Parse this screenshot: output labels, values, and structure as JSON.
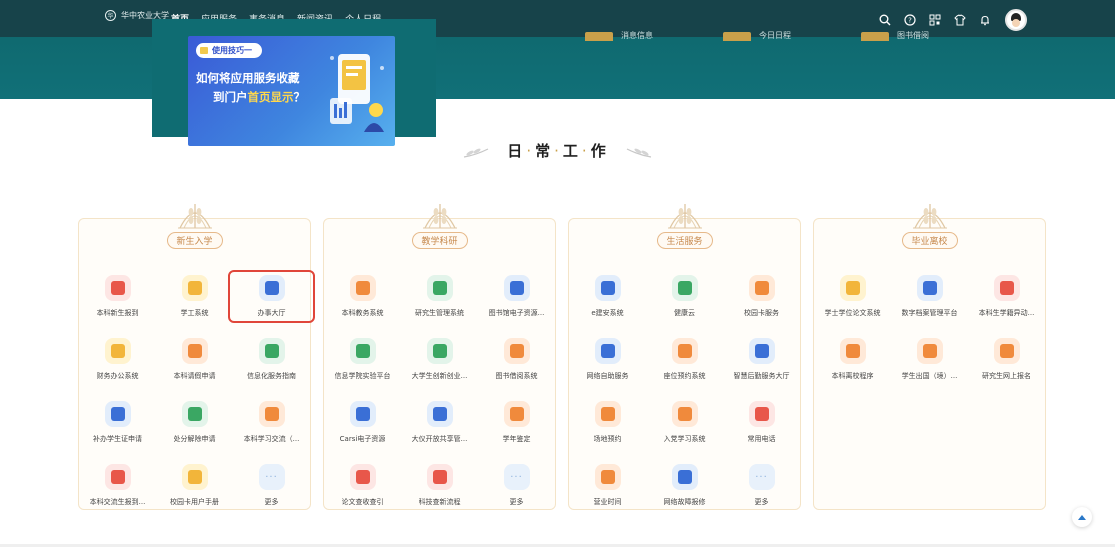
{
  "nav": {
    "brand": "华中农业大学",
    "items": [
      "首页",
      "应用服务",
      "事务消息",
      "新闻资讯",
      "个人日程"
    ],
    "icons": [
      "search-icon",
      "help-icon",
      "qrcode-icon",
      "shirt-icon",
      "bell-icon"
    ]
  },
  "quick_links": [
    "消息信息",
    "今日日程",
    "图书借阅"
  ],
  "banner": {
    "tip": "使用技巧一",
    "title_line1": "如何将应用服务收藏",
    "title_line2_pre": "到门户",
    "title_line2_hl": "首页显示",
    "title_line2_post": "？"
  },
  "section": {
    "title": [
      "日",
      "常",
      "工",
      "作"
    ]
  },
  "cards": [
    {
      "tag": "新生入学",
      "apps": [
        {
          "label": "本科新生报到",
          "color": "red"
        },
        {
          "label": "学工系统",
          "color": "yellow"
        },
        {
          "label": "办事大厅",
          "color": "blue",
          "highlight": true
        },
        {
          "label": "财务办公系统",
          "color": "yellow"
        },
        {
          "label": "本科请假申请",
          "color": "orange"
        },
        {
          "label": "信息化服务指南",
          "color": "green"
        },
        {
          "label": "补办学生证申请",
          "color": "blue"
        },
        {
          "label": "处分解除申请",
          "color": "green"
        },
        {
          "label": "本科学习交流（...",
          "color": "orange"
        },
        {
          "label": "本科交流生报到...",
          "color": "red"
        },
        {
          "label": "校园卡用户手册",
          "color": "yellow"
        },
        {
          "label": "更多",
          "color": "more"
        }
      ]
    },
    {
      "tag": "教学科研",
      "apps": [
        {
          "label": "本科教务系统",
          "color": "orange"
        },
        {
          "label": "研究生管理系统",
          "color": "green"
        },
        {
          "label": "图书馆电子资源...",
          "color": "blue"
        },
        {
          "label": "信息学院实验平台",
          "color": "green"
        },
        {
          "label": "大学生创新创业...",
          "color": "green"
        },
        {
          "label": "图书借阅系统",
          "color": "orange"
        },
        {
          "label": "Carsi电子资源",
          "color": "blue"
        },
        {
          "label": "大仪开放共享管...",
          "color": "blue"
        },
        {
          "label": "学年鉴定",
          "color": "orange"
        },
        {
          "label": "论文查收查引",
          "color": "red"
        },
        {
          "label": "科技查新流程",
          "color": "red"
        },
        {
          "label": "更多",
          "color": "more"
        }
      ]
    },
    {
      "tag": "生活服务",
      "apps": [
        {
          "label": "e建安系统",
          "color": "blue"
        },
        {
          "label": "健康云",
          "color": "green"
        },
        {
          "label": "校园卡服务",
          "color": "orange"
        },
        {
          "label": "网络自助服务",
          "color": "blue"
        },
        {
          "label": "座位预约系统",
          "color": "orange"
        },
        {
          "label": "智慧后勤服务大厅",
          "color": "blue"
        },
        {
          "label": "场地预约",
          "color": "orange"
        },
        {
          "label": "入党学习系统",
          "color": "orange"
        },
        {
          "label": "常用电话",
          "color": "red"
        },
        {
          "label": "营业时间",
          "color": "orange"
        },
        {
          "label": "网络故障报修",
          "color": "blue"
        },
        {
          "label": "更多",
          "color": "more"
        }
      ]
    },
    {
      "tag": "毕业离校",
      "apps": [
        {
          "label": "学士学位论文系统",
          "color": "yellow"
        },
        {
          "label": "数字档案管理平台",
          "color": "blue"
        },
        {
          "label": "本科生学籍异动...",
          "color": "red"
        },
        {
          "label": "本科离校程序",
          "color": "orange"
        },
        {
          "label": "学生出国（境）...",
          "color": "orange"
        },
        {
          "label": "研究生网上报名",
          "color": "orange"
        }
      ]
    }
  ]
}
